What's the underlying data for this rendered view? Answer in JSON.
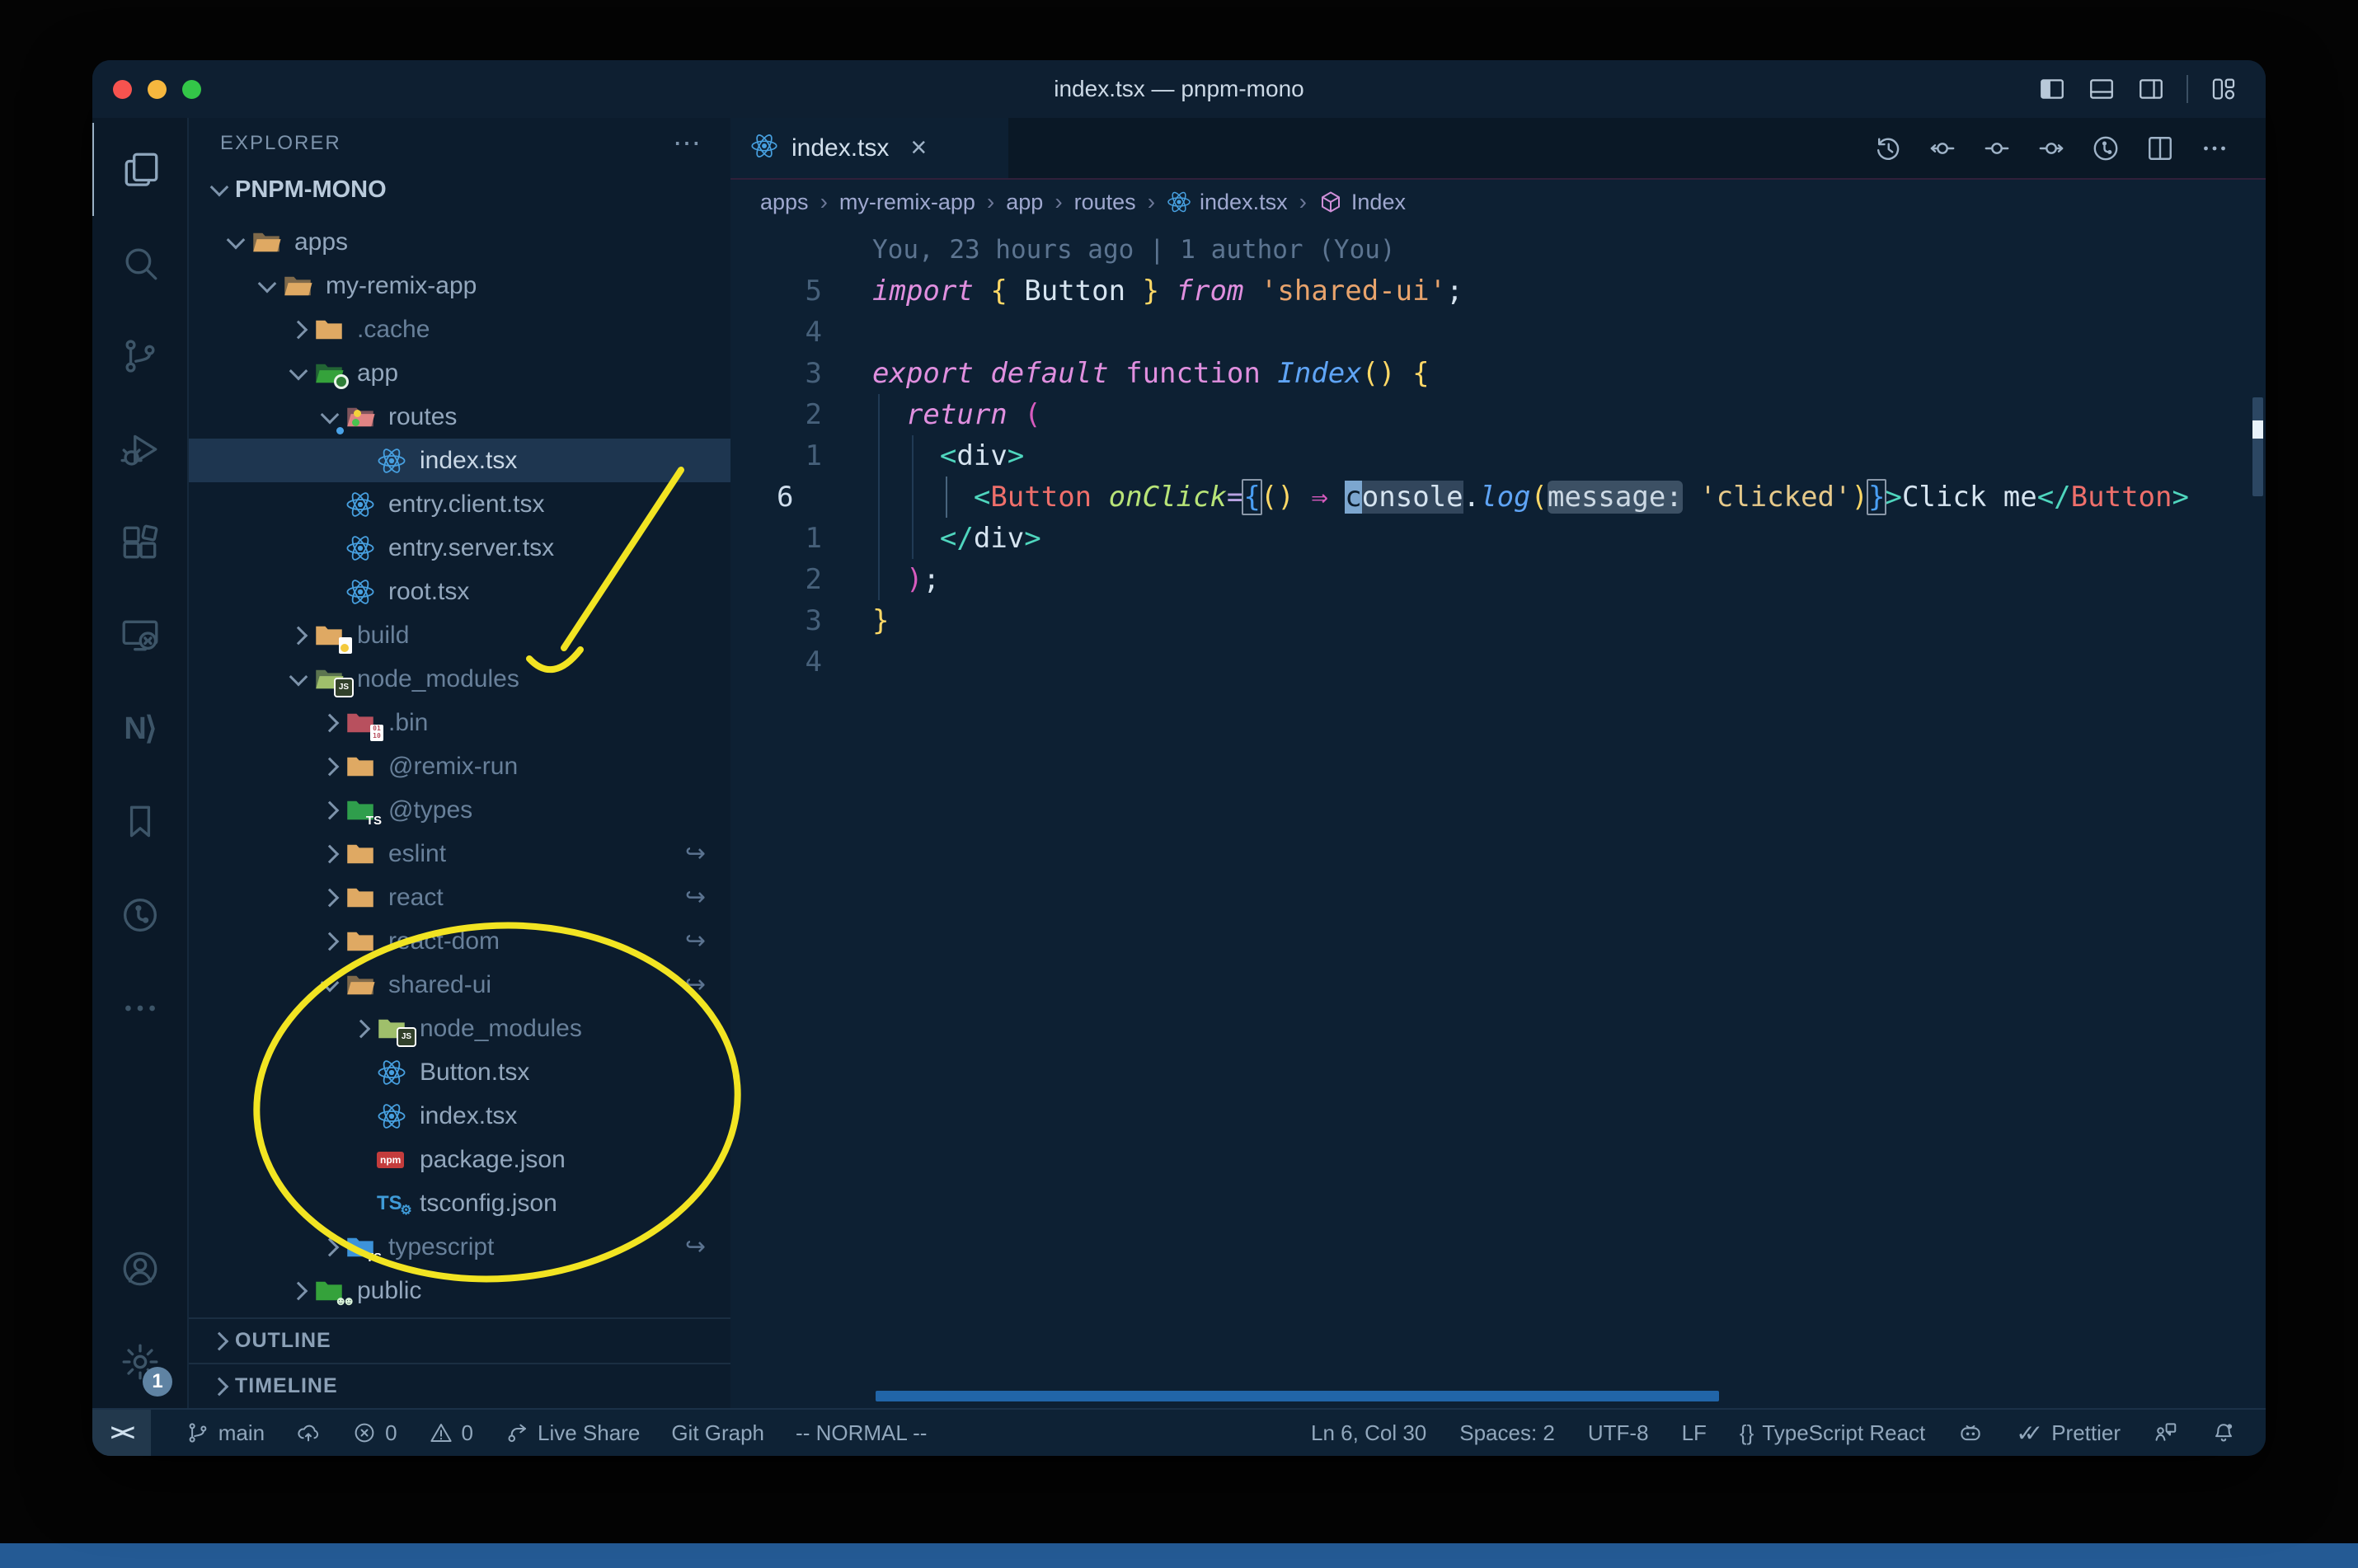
{
  "window": {
    "title": "index.tsx — pnpm-mono"
  },
  "titlebar": {
    "traffic_lights": [
      "#f6534f",
      "#f6b73e",
      "#33c648"
    ],
    "icons": [
      "layout-sidebar-left",
      "layout-panel",
      "layout-sidebar-right",
      "layout-customize"
    ]
  },
  "tab": {
    "label": "index.tsx",
    "close": "×"
  },
  "editor_toolbar": [
    "history",
    "prev-change",
    "changes",
    "next-change",
    "gitlens",
    "split-editor",
    "more"
  ],
  "breadcrumbs": {
    "sep": "›",
    "items": [
      {
        "label": "apps"
      },
      {
        "label": "my-remix-app"
      },
      {
        "label": "app"
      },
      {
        "label": "routes"
      },
      {
        "label": "index.tsx",
        "icon": "react"
      },
      {
        "label": "Index",
        "icon": "symbol-cube"
      }
    ]
  },
  "explorer": {
    "title": "EXPLORER",
    "more": "⋯",
    "root": "PNPM-MONO",
    "tree": [
      {
        "label": "apps",
        "level": 1,
        "chevron": "open",
        "icon": "folder",
        "open": true
      },
      {
        "label": "my-remix-app",
        "level": 2,
        "chevron": "open",
        "icon": "folder",
        "open": true
      },
      {
        "label": ".cache",
        "level": 3,
        "chevron": "closed",
        "icon": "folder",
        "dim": true
      },
      {
        "label": "app",
        "level": 3,
        "chevron": "open",
        "icon": "folder-app",
        "open": true
      },
      {
        "label": "routes",
        "level": 4,
        "chevron": "open",
        "icon": "folder-routes",
        "open": true
      },
      {
        "label": "index.tsx",
        "level": 5,
        "chevron": "none",
        "icon": "react",
        "selected": true
      },
      {
        "label": "entry.client.tsx",
        "level": 4,
        "chevron": "none",
        "icon": "react"
      },
      {
        "label": "entry.server.tsx",
        "level": 4,
        "chevron": "none",
        "icon": "react"
      },
      {
        "label": "root.tsx",
        "level": 4,
        "chevron": "none",
        "icon": "react"
      },
      {
        "label": "build",
        "level": 3,
        "chevron": "closed",
        "icon": "folder-build",
        "dim": true
      },
      {
        "label": "node_modules",
        "level": 3,
        "chevron": "open",
        "icon": "folder-node",
        "open": true,
        "dim": true
      },
      {
        "label": ".bin",
        "level": 4,
        "chevron": "closed",
        "icon": "folder-bin",
        "dim": true
      },
      {
        "label": "@remix-run",
        "level": 4,
        "chevron": "closed",
        "icon": "folder",
        "dim": true
      },
      {
        "label": "@types",
        "level": 4,
        "chevron": "closed",
        "icon": "folder-types",
        "dim": true
      },
      {
        "label": "eslint",
        "level": 4,
        "chevron": "closed",
        "icon": "folder",
        "dim": true,
        "symlink": true
      },
      {
        "label": "react",
        "level": 4,
        "chevron": "closed",
        "icon": "folder",
        "dim": true,
        "symlink": true
      },
      {
        "label": "react-dom",
        "level": 4,
        "chevron": "closed",
        "icon": "folder",
        "dim": true,
        "symlink": true
      },
      {
        "label": "shared-ui",
        "level": 4,
        "chevron": "open",
        "icon": "folder",
        "open": true,
        "dim": true,
        "symlink": true
      },
      {
        "label": "node_modules",
        "level": 5,
        "chevron": "closed",
        "icon": "folder-node",
        "dim": true
      },
      {
        "label": "Button.tsx",
        "level": 5,
        "chevron": "none",
        "icon": "react"
      },
      {
        "label": "index.tsx",
        "level": 5,
        "chevron": "none",
        "icon": "react"
      },
      {
        "label": "package.json",
        "level": 5,
        "chevron": "none",
        "icon": "npm"
      },
      {
        "label": "tsconfig.json",
        "level": 5,
        "chevron": "none",
        "icon": "tsconfig"
      },
      {
        "label": "typescript",
        "level": 4,
        "chevron": "closed",
        "icon": "folder-ts",
        "dim": true,
        "symlink": true
      },
      {
        "label": "public",
        "level": 3,
        "chevron": "closed",
        "icon": "folder-public"
      }
    ],
    "sections": [
      {
        "label": "OUTLINE"
      },
      {
        "label": "TIMELINE"
      }
    ]
  },
  "editor": {
    "blame": "You, 23 hours ago | 1 author (You)",
    "lines": [
      {
        "num": "",
        "blame": true,
        "text": "You, 23 hours ago | 1 author (You)"
      },
      {
        "num": "5",
        "tokens": [
          {
            "t": "import",
            "s": "kw"
          },
          {
            "t": " ",
            "s": "pl"
          },
          {
            "t": "{",
            "s": "yb"
          },
          {
            "t": " Button ",
            "s": "pl"
          },
          {
            "t": "}",
            "s": "yb"
          },
          {
            "t": " ",
            "s": "pl"
          },
          {
            "t": "from",
            "s": "kw"
          },
          {
            "t": " ",
            "s": "pl"
          },
          {
            "t": "'shared-ui'",
            "s": "str"
          },
          {
            "t": ";",
            "s": "pl"
          }
        ]
      },
      {
        "num": "4",
        "tokens": []
      },
      {
        "num": "3",
        "tokens": [
          {
            "t": "export",
            "s": "kw"
          },
          {
            "t": " ",
            "s": "pl"
          },
          {
            "t": "default",
            "s": "kw"
          },
          {
            "t": " ",
            "s": "pl"
          },
          {
            "t": "function",
            "s": "kw2"
          },
          {
            "t": " ",
            "s": "pl"
          },
          {
            "t": "Index",
            "s": "fn"
          },
          {
            "t": "()",
            "s": "yb"
          },
          {
            "t": " ",
            "s": "pl"
          },
          {
            "t": "{",
            "s": "yb"
          }
        ]
      },
      {
        "num": "2",
        "guides": [
          0
        ],
        "tokens": [
          {
            "t": "  ",
            "s": "pl"
          },
          {
            "t": "return",
            "s": "kw"
          },
          {
            "t": " ",
            "s": "pl"
          },
          {
            "t": "(",
            "s": "pk"
          }
        ]
      },
      {
        "num": "1",
        "guides": [
          0,
          2
        ],
        "tokens": [
          {
            "t": "    ",
            "s": "pl"
          },
          {
            "t": "<",
            "s": "tag"
          },
          {
            "t": "div",
            "s": "pl"
          },
          {
            "t": ">",
            "s": "tag"
          }
        ]
      },
      {
        "num": "6",
        "current": true,
        "guides": [
          0,
          2
        ],
        "ag": 4,
        "tokens": [
          {
            "t": "      ",
            "s": "pl"
          },
          {
            "t": "<",
            "s": "tag"
          },
          {
            "t": "Button",
            "s": "comp"
          },
          {
            "t": " ",
            "s": "pl"
          },
          {
            "t": "onClick",
            "s": "attr"
          },
          {
            "t": "=",
            "s": "eq"
          },
          {
            "t": "{",
            "s": "bb"
          },
          {
            "t": "()",
            "s": "yb"
          },
          {
            "t": " ",
            "s": "pl"
          },
          {
            "t": "⇒",
            "s": "pk"
          },
          {
            "t": " ",
            "s": "pl"
          },
          {
            "t": "c",
            "s": "cur"
          },
          {
            "t": "onsole",
            "s": "whl"
          },
          {
            "t": ".",
            "s": "pl"
          },
          {
            "t": "log",
            "s": "fn"
          },
          {
            "t": "(",
            "s": "yb"
          },
          {
            "t": "message:",
            "s": "inlay"
          },
          {
            "t": " ",
            "s": "pl"
          },
          {
            "t": "'clicked'",
            "s": "str2"
          },
          {
            "t": ")",
            "s": "yb"
          },
          {
            "t": "}",
            "s": "bb"
          },
          {
            "t": ">",
            "s": "tag"
          },
          {
            "t": "Click me",
            "s": "pl"
          },
          {
            "t": "</",
            "s": "tag"
          },
          {
            "t": "Button",
            "s": "comp"
          },
          {
            "t": ">",
            "s": "tag"
          }
        ]
      },
      {
        "num": "1",
        "guides": [
          0,
          2
        ],
        "tokens": [
          {
            "t": "    ",
            "s": "pl"
          },
          {
            "t": "</",
            "s": "tag"
          },
          {
            "t": "div",
            "s": "pl"
          },
          {
            "t": ">",
            "s": "tag"
          }
        ]
      },
      {
        "num": "2",
        "guides": [
          0
        ],
        "tokens": [
          {
            "t": "  ",
            "s": "pl"
          },
          {
            "t": ")",
            "s": "pk"
          },
          {
            "t": ";",
            "s": "pl"
          }
        ]
      },
      {
        "num": "3",
        "tokens": [
          {
            "t": "}",
            "s": "yb"
          }
        ]
      },
      {
        "num": "4",
        "tokens": []
      }
    ]
  },
  "activity": {
    "top": [
      {
        "name": "explorer",
        "active": true
      },
      {
        "name": "search"
      },
      {
        "name": "source-control"
      },
      {
        "name": "run-debug"
      },
      {
        "name": "extensions"
      },
      {
        "name": "remote-explorer"
      },
      {
        "name": "nx-console"
      },
      {
        "name": "bookmarks"
      },
      {
        "name": "gitlens"
      },
      {
        "name": "more"
      }
    ],
    "bottom": [
      {
        "name": "account"
      },
      {
        "name": "settings",
        "badge": "1"
      }
    ]
  },
  "status": {
    "left": [
      {
        "name": "remote",
        "remote": true,
        "label": "><"
      },
      {
        "name": "branch",
        "icon": "branch",
        "label": "main"
      },
      {
        "name": "sync",
        "icon": "cloud-upload",
        "label": ""
      },
      {
        "name": "errors",
        "icon": "error",
        "label": "0"
      },
      {
        "name": "warnings",
        "icon": "warning",
        "label": "0"
      },
      {
        "name": "live-share",
        "icon": "live-share",
        "label": "Live Share"
      },
      {
        "name": "git-graph",
        "label": "Git Graph"
      },
      {
        "name": "vim-mode",
        "label": "-- NORMAL --"
      }
    ],
    "right": [
      {
        "name": "cursor-position",
        "label": "Ln 6, Col 30"
      },
      {
        "name": "indentation",
        "label": "Spaces: 2"
      },
      {
        "name": "encoding",
        "label": "UTF-8"
      },
      {
        "name": "eol",
        "label": "LF"
      },
      {
        "name": "language-mode",
        "icon": "braces",
        "label": "TypeScript React"
      },
      {
        "name": "copilot",
        "icon": "copilot",
        "label": ""
      },
      {
        "name": "prettier",
        "icon": "double-check",
        "label": "Prettier"
      },
      {
        "name": "feedback",
        "icon": "feedback",
        "label": ""
      },
      {
        "name": "notifications",
        "icon": "bell",
        "label": ""
      }
    ]
  },
  "colors": {
    "annotation_yellow": "#f2e422",
    "editor_bg": "#0d2033",
    "sidebar_bg": "#0c1c2d",
    "statusbar_bg": "#0e2235",
    "selection_row": "#1e3650",
    "scrollbar_blue": "#2165a8",
    "folder_tan": "#dfa963",
    "react_blue": "#47a0e0"
  }
}
